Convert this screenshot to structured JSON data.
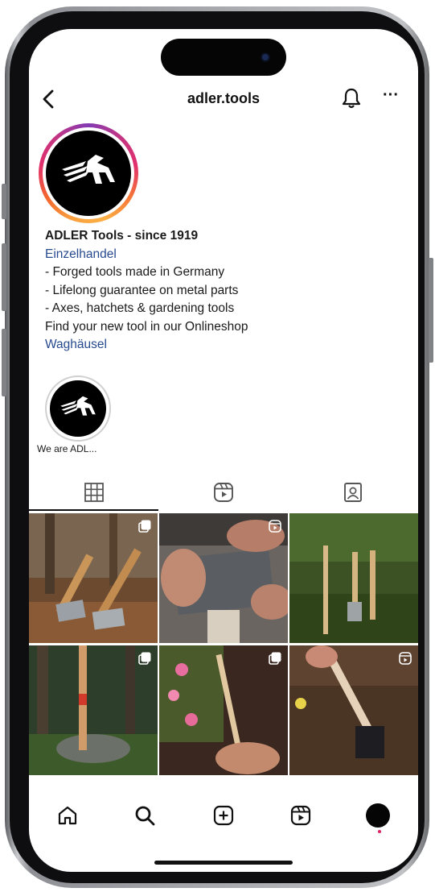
{
  "header": {
    "username": "adler.tools",
    "back_icon": "chevron-left-icon",
    "notification_icon": "bell-icon",
    "more_label": "···"
  },
  "profile": {
    "name": "ADLER Tools - since 1919",
    "category": "Einzelhandel",
    "bio_lines": [
      "- Forged tools made in Germany",
      "- Lifelong guarantee on metal parts",
      "- Axes, hatchets & gardening tools",
      "Find your new tool in our Onlineshop"
    ],
    "location": "Waghäusel"
  },
  "highlight": {
    "label": "We are ADL..."
  },
  "tabs": [
    {
      "icon": "grid-icon",
      "active": true
    },
    {
      "icon": "reels-icon",
      "active": false
    },
    {
      "icon": "tagged-icon",
      "active": false
    }
  ],
  "posts": [
    {
      "type": "carousel",
      "subject": "two axes in forest leaves"
    },
    {
      "type": "reel",
      "subject": "hands holding axe head"
    },
    {
      "type": "none",
      "subject": "garden tools hanging in greenery"
    },
    {
      "type": "carousel",
      "subject": "axe on forest stump"
    },
    {
      "type": "carousel",
      "subject": "hand trowel with pink flowers"
    },
    {
      "type": "reel",
      "subject": "spade digging soil"
    }
  ],
  "bottom_nav": [
    {
      "icon": "home-icon"
    },
    {
      "icon": "search-icon"
    },
    {
      "icon": "create-icon"
    },
    {
      "icon": "reels-icon"
    },
    {
      "icon": "profile-avatar-icon"
    }
  ],
  "colors": {
    "link_blue": "#274a8f",
    "story_ring": [
      "#fcaf45",
      "#e1306c",
      "#833ab4"
    ],
    "text": "#1a1a1a"
  }
}
